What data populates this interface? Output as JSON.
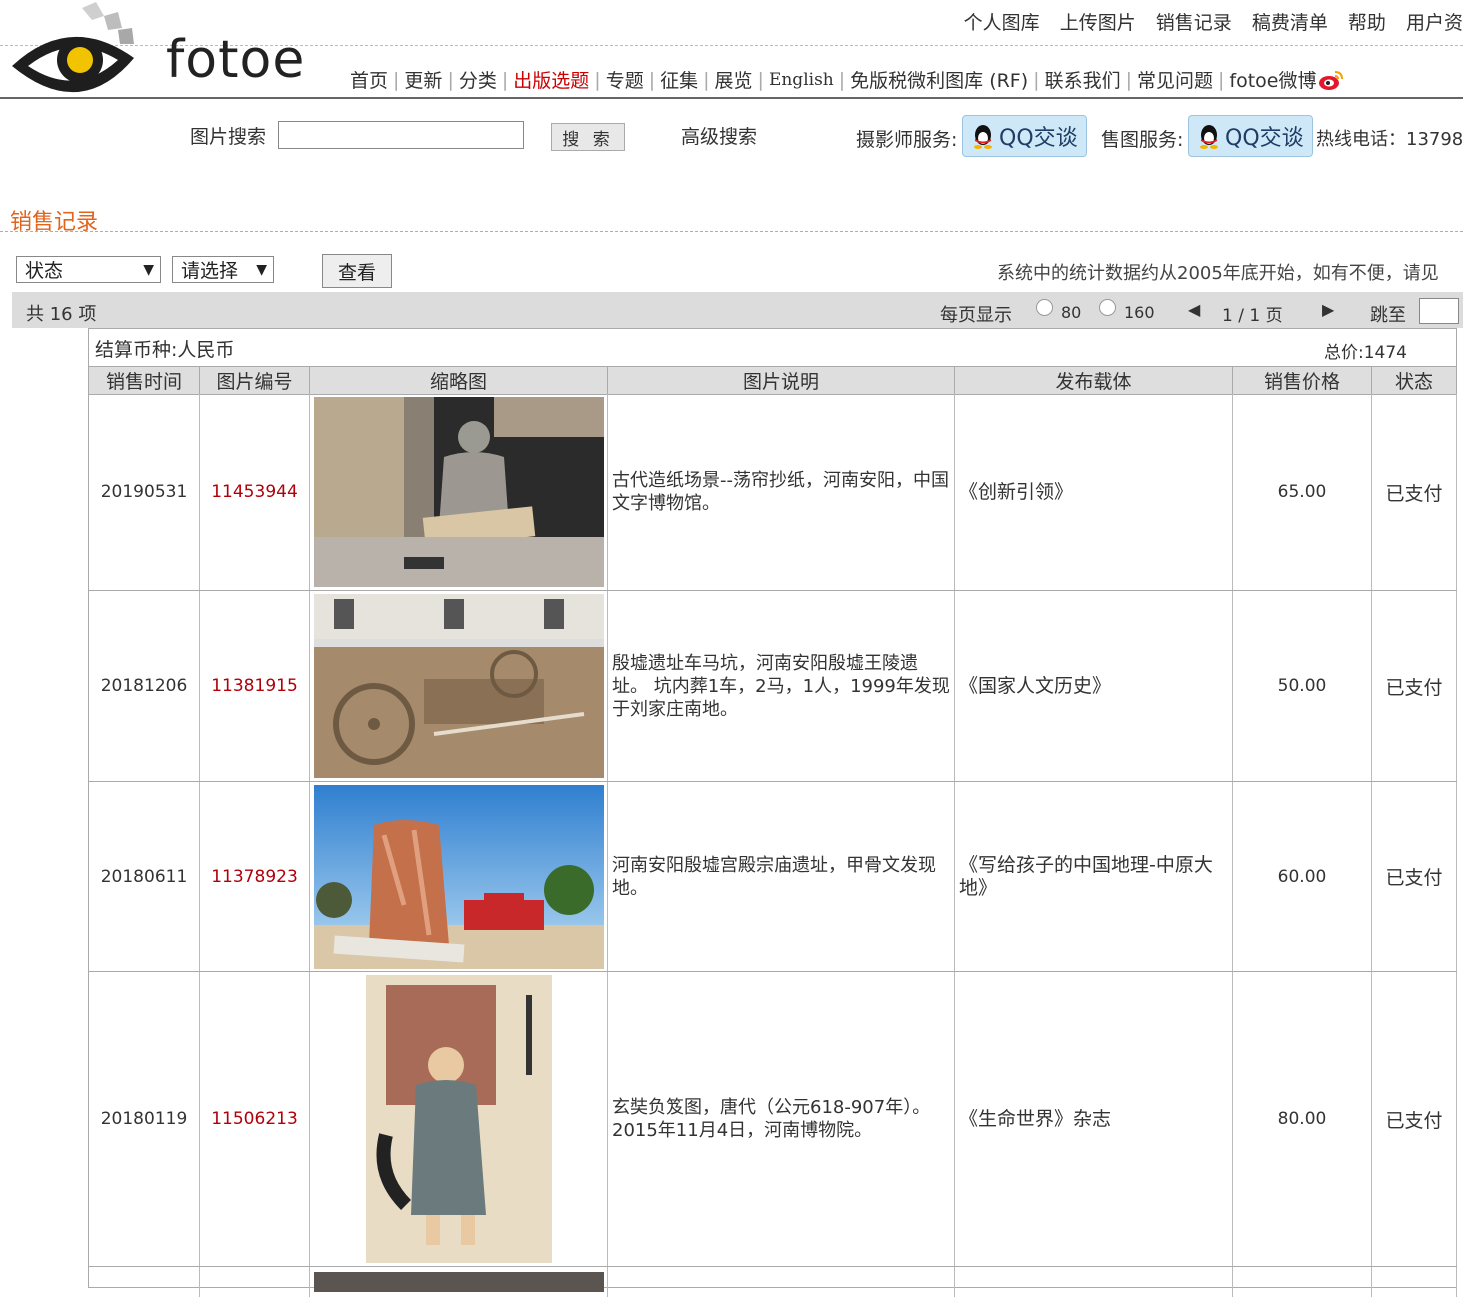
{
  "top_nav": [
    "个人图库",
    "上传图片",
    "销售记录",
    "稿费清单",
    "帮助",
    "用户资"
  ],
  "logo": {
    "text": "fotoe"
  },
  "main_nav": [
    {
      "label": "首页"
    },
    {
      "label": "更新"
    },
    {
      "label": "分类"
    },
    {
      "label": "出版选题",
      "highlight": true
    },
    {
      "label": "专题"
    },
    {
      "label": "征集"
    },
    {
      "label": "展览"
    },
    {
      "label": "English"
    },
    {
      "label": "免版税微利图库 (RF)"
    },
    {
      "label": "联系我们"
    },
    {
      "label": "常见问题"
    },
    {
      "label": "fotoe微博"
    }
  ],
  "search": {
    "label": "图片搜索",
    "value": "",
    "button": "搜 索",
    "advanced": "高级搜索"
  },
  "services": {
    "photographer_label": "摄影师服务:",
    "sales_label": "售图服务:",
    "qq_label": "QQ交谈",
    "hotline": "热线电话：13798"
  },
  "section": {
    "title": "销售记录"
  },
  "filters": {
    "status_select": "状态",
    "choose_select": "请选择",
    "view_button": "查看",
    "note": "系统中的统计数据约从2005年底开始，如有不便，请见"
  },
  "pager": {
    "total": "共 16 项",
    "per_page_label": "每页显示",
    "option_80": "80",
    "option_160": "160",
    "prev": "◀",
    "page_info": "1 / 1 页",
    "next": "▶",
    "jump_label": "跳至"
  },
  "table": {
    "currency": "结算币种:人民币",
    "total_price": "总价:1474",
    "headers": [
      "销售时间",
      "图片编号",
      "缩略图",
      "图片说明",
      "发布载体",
      "销售价格",
      "状态"
    ],
    "rows": [
      {
        "time": "20190531",
        "id": "11453944",
        "desc": "古代造纸场景--荡帘抄纸，河南安阳，中国文字博物馆。",
        "media": "《创新引领》",
        "price": "65.00",
        "status": "已支付"
      },
      {
        "time": "20181206",
        "id": "11381915",
        "desc": "殷墟遗址车马坑，河南安阳殷墟王陵遗址。 坑内葬1车，2马，1人，1999年发现于刘家庄南地。",
        "media": "《国家人文历史》",
        "price": "50.00",
        "status": "已支付"
      },
      {
        "time": "20180611",
        "id": "11378923",
        "desc": "河南安阳殷墟宫殿宗庙遗址，甲骨文发现地。",
        "media": "《写给孩子的中国地理-中原大地》",
        "price": "60.00",
        "status": "已支付"
      },
      {
        "time": "20180119",
        "id": "11506213",
        "desc": "玄奘负笈图，唐代（公元618-907年）。2015年11月4日，河南博物院。",
        "media": "《生命世界》杂志",
        "price": "80.00",
        "status": "已支付"
      }
    ]
  }
}
